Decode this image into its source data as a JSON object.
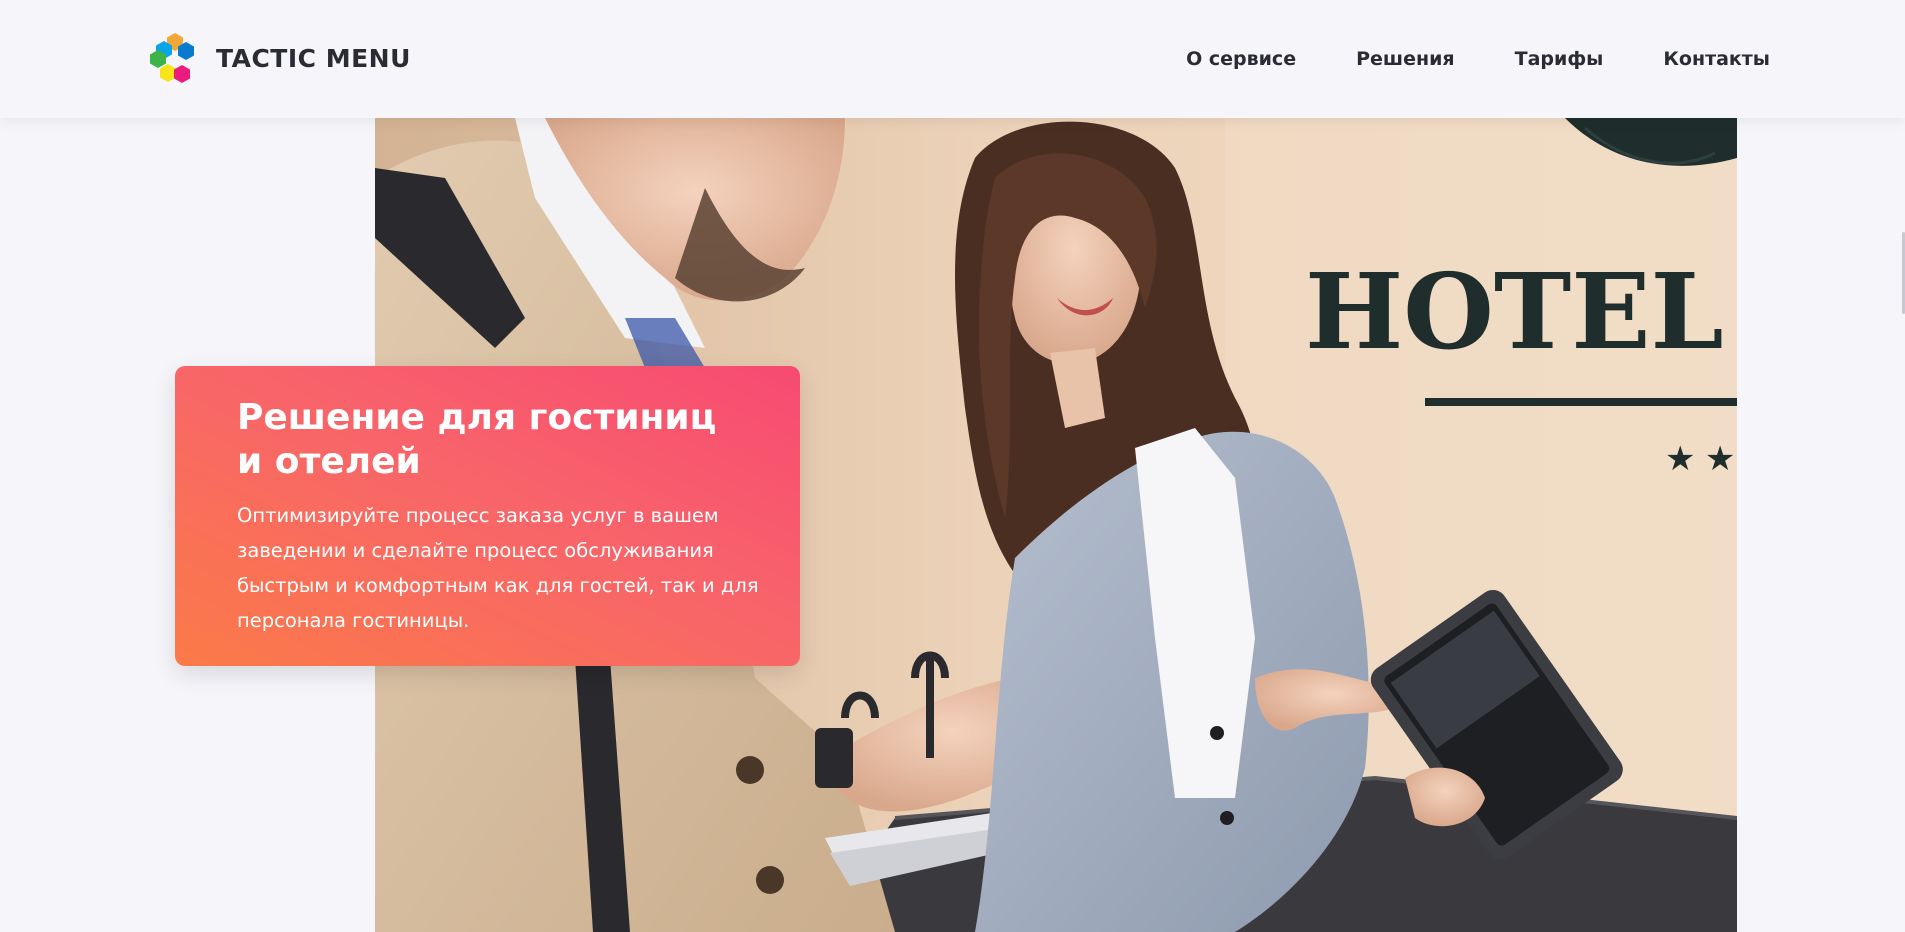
{
  "brand": {
    "name": "TACTIC MENU",
    "hex_colors": [
      "#0aa5e6",
      "#f0a838",
      "#3cb44a",
      "#0a7ad0",
      "#f7e51a",
      "#ec1c7e"
    ]
  },
  "nav": {
    "items": [
      {
        "label": "О сервисе"
      },
      {
        "label": "Решения"
      },
      {
        "label": "Тарифы"
      },
      {
        "label": "Контакты"
      }
    ]
  },
  "hero": {
    "title_line1": "Решение для гостиниц",
    "title_line2": "и отелей",
    "description": "Оптимизируйте процесс заказа услуг в вашем заведении и сделайте процесс обслуживания быстрым и комфортным как для гостей, так и для персонала гостиницы.",
    "card_gradient": [
      "#f74a72",
      "#fb7a48"
    ],
    "photo_sign_text": "HOTEL G"
  },
  "icons": {
    "logo": "hexagon-cluster-logo-icon"
  }
}
